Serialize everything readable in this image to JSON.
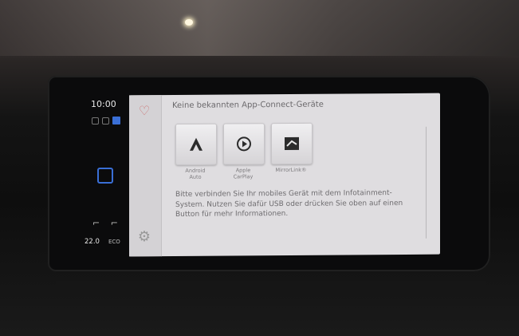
{
  "status": {
    "time": "10:00",
    "temperature": "22.0",
    "eco_label": "ECO"
  },
  "screen": {
    "title": "Keine bekannten App-Connect-Geräte",
    "apps": [
      {
        "label_line1": "Android",
        "label_line2": "Auto",
        "icon": "android-auto-icon"
      },
      {
        "label_line1": "Apple",
        "label_line2": "CarPlay",
        "icon": "apple-carplay-icon"
      },
      {
        "label_line1": "MirrorLink®",
        "label_line2": "",
        "icon": "mirrorlink-icon"
      }
    ],
    "message": "Bitte verbinden Sie Ihr mobiles Gerät mit dem Infotainment-System. Nutzen Sie dafür USB oder drücken Sie oben auf einen Button für mehr Informationen."
  },
  "colors": {
    "screen_bg": "#dfdde0",
    "accent_blue": "#3a6fd6",
    "text": "#6f6d70"
  }
}
